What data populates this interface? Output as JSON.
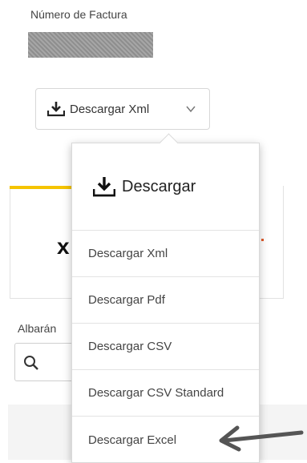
{
  "invoice": {
    "label": "Número de Factura"
  },
  "download_button": {
    "label": "Descargar Xml",
    "icon": "download-icon",
    "chevron": "chevron-down-icon"
  },
  "menu": {
    "header": "Descargar",
    "items": [
      {
        "label": "Descargar Xml"
      },
      {
        "label": "Descargar Pdf"
      },
      {
        "label": "Descargar CSV"
      },
      {
        "label": "Descargar CSV Standard"
      },
      {
        "label": "Descargar Excel"
      }
    ]
  },
  "background": {
    "albaran_label": "Albarán",
    "search_icon": "search-icon"
  },
  "colors": {
    "accent": "#f5c400",
    "icon": "#222222",
    "border": "#d9d9d9",
    "arrow": "#555555"
  }
}
